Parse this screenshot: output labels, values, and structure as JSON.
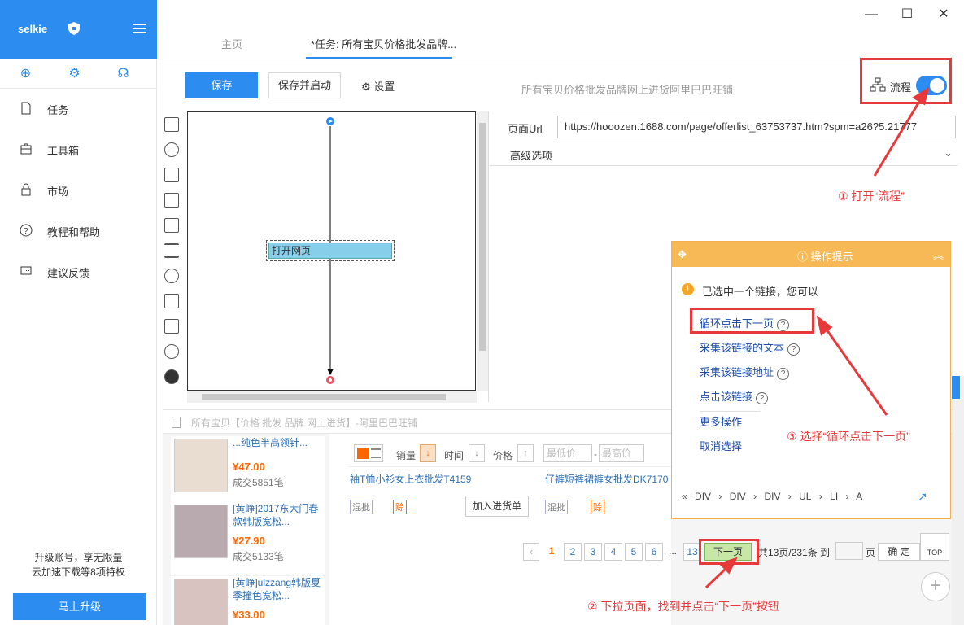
{
  "app": {
    "brand": "selkie",
    "window_controls": [
      "—",
      "☐",
      "✕"
    ]
  },
  "sidebar": {
    "items": [
      {
        "label": "任务"
      },
      {
        "label": "工具箱"
      },
      {
        "label": "市场"
      },
      {
        "label": "教程和帮助"
      },
      {
        "label": "建议反馈"
      }
    ],
    "upgrade_line1": "升级账号，享无限量",
    "upgrade_line2": "云加速下载等8项特权",
    "upgrade_button": "马上升级"
  },
  "tabs": {
    "home": "主页",
    "task": "*任务: 所有宝贝价格批发品牌..."
  },
  "toolbar": {
    "save": "保存",
    "save_run": "保存并启动",
    "settings": "设置",
    "task_title": "所有宝贝价格批发品牌网上进货阿里巴巴旺铺",
    "flow_label": "流程",
    "flow_enabled": true
  },
  "flow": {
    "node_open_page": "打开网页"
  },
  "props": {
    "url_label": "页面Url",
    "url_value": "https://hooozen.1688.com/page/offerlist_63753737.htm?spm=a26?5.21777",
    "advanced": "高级选项"
  },
  "browser": {
    "page_title": "所有宝贝【价格 批发 品牌 网上进货】-阿里巴巴旺铺",
    "products": [
      {
        "name": "...纯色半高领针...",
        "price": "¥47.00",
        "sold": "成交5851笔"
      },
      {
        "name": "[黄峥]2017东大门春款韩版宽松...",
        "price": "¥27.90",
        "sold": "成交5133笔"
      },
      {
        "name": "[黄峥]ulzzang韩版夏季撞色宽松...",
        "price": "¥33.00",
        "sold": ""
      }
    ],
    "sort": {
      "sales": "销量",
      "time": "时间",
      "price": "价格",
      "min_placeholder": "最低价",
      "dash": "-",
      "max_placeholder": "最高价"
    },
    "items": [
      {
        "title": "袖T恤小衫女上衣批发T4159"
      },
      {
        "title": "仔裤短裤裙裤女批发DK7170"
      }
    ],
    "tag_mix": "混批",
    "tag_pay": "赊",
    "add_cart": "加入进货单",
    "pagination": {
      "pages": [
        "1",
        "2",
        "3",
        "4",
        "5",
        "6",
        "...",
        "13"
      ],
      "next": "下一页",
      "info": "共13页/231条 到",
      "ye": "页",
      "ok": "确 定"
    },
    "top": "TOP"
  },
  "tips": {
    "title": "操作提示",
    "message": "已选中一个链接，您可以",
    "links": [
      "循环点击下一页",
      "采集该链接的文本",
      "采集该链接地址",
      "点击该链接",
      "更多操作",
      "取消选择"
    ],
    "breadcrumb": [
      "«",
      "DIV",
      "›",
      "DIV",
      "›",
      "DIV",
      "›",
      "UL",
      "›",
      "LI",
      "›",
      "A"
    ]
  },
  "annotations": {
    "step1": "① 打开“流程”",
    "step2": "② 下拉页面，找到并点击“下一页”按钮",
    "step3": "③ 选择“循环点击下一页”"
  },
  "colors": {
    "primary": "#2d8cf0",
    "annotation": "#e8393a",
    "tips_header": "#f7b955",
    "price": "#ff6600"
  }
}
